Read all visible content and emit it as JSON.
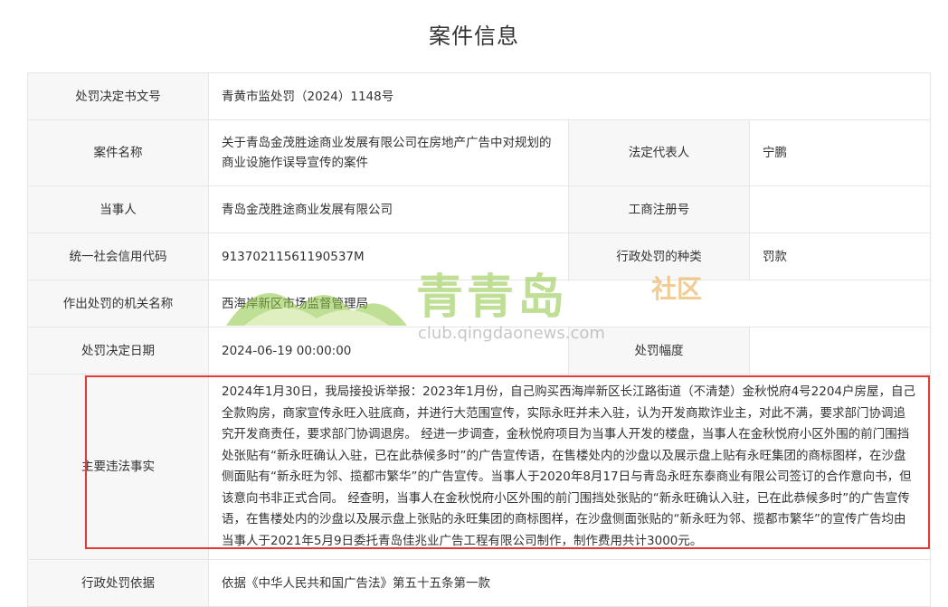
{
  "page": {
    "title": "案件信息"
  },
  "rows": {
    "decision_no": {
      "label": "处罚决定书文号",
      "value": "青黄市监处罚（2024）1148号"
    },
    "case_name": {
      "label": "案件名称",
      "value": "关于青岛金茂胜途商业发展有限公司在房地产广告中对规划的商业设施作误导宣传的案件"
    },
    "legal_rep": {
      "label": "法定代表人",
      "value": "宁鹏"
    },
    "party": {
      "label": "当事人",
      "value": "青岛金茂胜途商业发展有限公司"
    },
    "reg_no": {
      "label": "工商注册号",
      "value": ""
    },
    "credit_code": {
      "label": "统一社会信用代码",
      "value": "91370211561190537M"
    },
    "penalty_type": {
      "label": "行政处罚的种类",
      "value": "罚款"
    },
    "authority": {
      "label": "作出处罚的机关名称",
      "value": "西海岸新区市场监督管理局"
    },
    "decision_date": {
      "label": "处罚决定日期",
      "value": "2024-06-19 00:00:00"
    },
    "penalty_range": {
      "label": "处罚幅度",
      "value": ""
    },
    "facts": {
      "label": "主要违法事实",
      "value": "2024年1月30日，我局接投诉举报：2023年1月份，自己购买西海岸新区长江路街道（不清楚）金秋悦府4号2204户房屋，自己全款购房，商家宣传永旺入驻底商，并进行大范围宣传，实际永旺并未入驻，认为开发商欺诈业主，对此不满，要求部门协调追究开发商责任，要求部门协调退房。 经进一步调查，金秋悦府项目为当事人开发的楼盘，当事人在金秋悦府小区外围的前门围挡处张贴有“新永旺确认入驻，已在此恭候多时”的广告宣传语，在售楼处内的沙盘以及展示盘上贴有永旺集团的商标图样，在沙盘侧面贴有“新永旺为邻、揽都市繁华”的广告宣传。当事人于2020年8月17日与青岛永旺东泰商业有限公司签订的合作意向书，但该意向书非正式合同。 经查明，当事人在金秋悦府小区外围的前门围挡处张贴的“新永旺确认入驻，已在此恭候多时”的广告宣传语，在售楼处内的沙盘以及展示盘上张贴的永旺集团的商标图样，在沙盘侧面张贴的“新永旺为邻、揽都市繁华”的宣传广告均由当事人于2021年5月9日委托青岛佳兆业广告工程有限公司制作，制作费用共计3000元。"
    },
    "basis": {
      "label": "行政处罚依据",
      "value": "依据《中华人民共和国广告法》第五十五条第一款"
    }
  },
  "watermark": {
    "text": "青青岛",
    "sub": "社区",
    "url": "club.qingdaonews.com",
    "logo_icon": "green-hills-logo-icon",
    "colors": {
      "green": "#8cc63f",
      "orange": "#e8a33a",
      "highlight": "#e53935"
    }
  }
}
